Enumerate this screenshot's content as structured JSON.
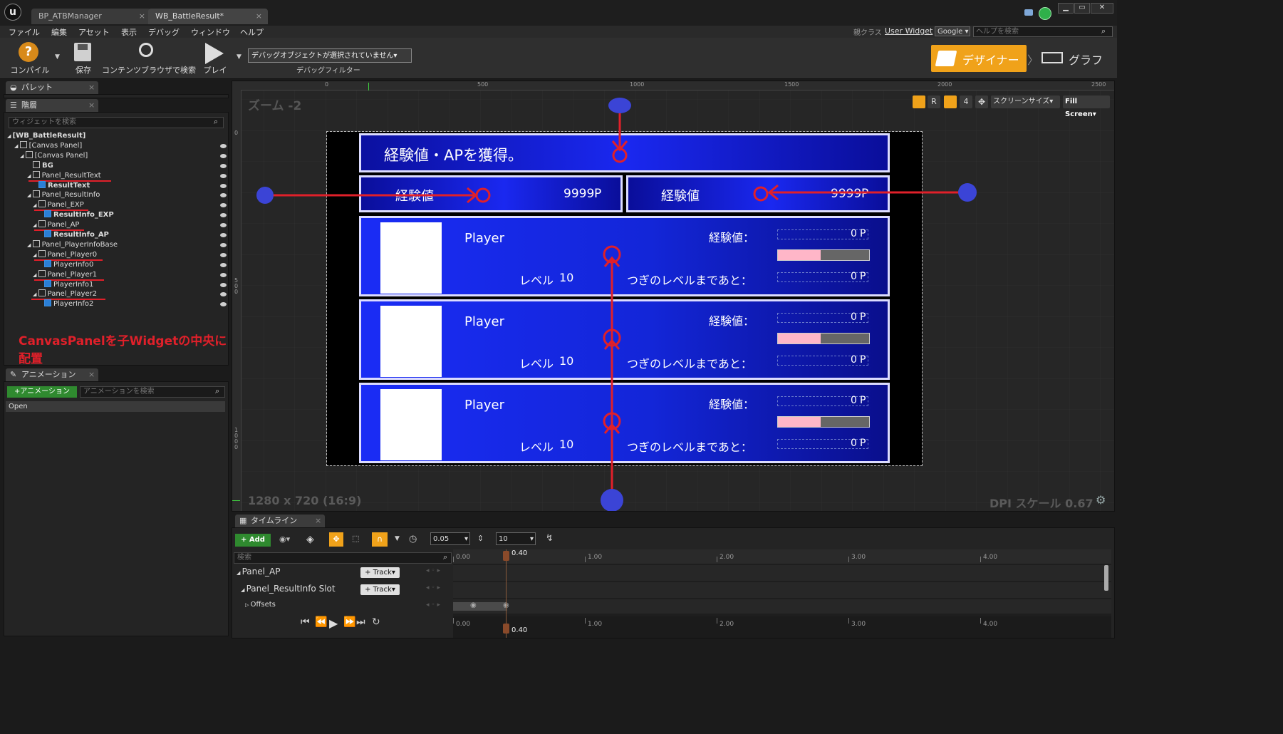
{
  "window": {
    "tabs": [
      {
        "label": "BP_ATBManager"
      },
      {
        "label": "WB_BattleResult*"
      }
    ],
    "controls": {
      "minimize": "▁",
      "maximize": "▭",
      "close": "✕"
    }
  },
  "menu": [
    "ファイル",
    "編集",
    "アセット",
    "表示",
    "デバッグ",
    "ウィンドウ",
    "ヘルプ"
  ],
  "parent_class": {
    "label": "親クラス",
    "value": "User Widget"
  },
  "search_engine": "Google",
  "help_search": {
    "placeholder": "ヘルプを検索"
  },
  "toolbar": {
    "compile": "コンパイル",
    "save": "保存",
    "browse": "コンテンツブラウザで検索",
    "play": "プレイ",
    "debug_object": "デバッグオブジェクトが選択されていません",
    "debug_filter": "デバッグフィルター"
  },
  "mode": {
    "designer": "デザイナー",
    "graph": "グラフ"
  },
  "palette": {
    "tab": "パレット"
  },
  "hierarchy": {
    "tab": "階層",
    "search_placeholder": "ウィジェットを検索",
    "items": [
      {
        "label": "[WB_BattleResult]",
        "bold": true
      },
      {
        "label": "[Canvas Panel]"
      },
      {
        "label": "[Canvas Panel]"
      },
      {
        "label": "BG",
        "bold": true
      },
      {
        "label": "Panel_ResultText"
      },
      {
        "label": "ResultText",
        "bold": true
      },
      {
        "label": "Panel_ResultInfo"
      },
      {
        "label": "Panel_EXP"
      },
      {
        "label": "ResultInfo_EXP",
        "bold": true
      },
      {
        "label": "Panel_AP"
      },
      {
        "label": "ResultInfo_AP",
        "bold": true
      },
      {
        "label": "Panel_PlayerInfoBase"
      },
      {
        "label": "Panel_Player0"
      },
      {
        "label": "PlayerInfo0"
      },
      {
        "label": "Panel_Player1"
      },
      {
        "label": "PlayerInfo1"
      },
      {
        "label": "Panel_Player2"
      },
      {
        "label": "PlayerInfo2"
      }
    ],
    "annotation": "CanvasPanelを子Widgetの中央に配置"
  },
  "animation": {
    "tab": "アニメーション",
    "add_button": "+アニメーション",
    "search_placeholder": "アニメーションを検索",
    "items": [
      "Open"
    ]
  },
  "viewport": {
    "zoom": "ズーム -2",
    "ruler_top": [
      "0",
      "500",
      "1000",
      "1500",
      "2000",
      "2500"
    ],
    "ruler_left": [
      "0",
      "5\n0\n0",
      "1\n0\n0\n0"
    ],
    "buttons": {
      "r": "R",
      "four": "4",
      "screen_size": "スクリーンサイズ",
      "fill": "Fill Screen"
    },
    "resolution": "1280 x 720 (16:9)",
    "dpi": "DPI スケール 0.67"
  },
  "game_ui": {
    "title": "経験値・APを獲得。",
    "exp_label": "経験値",
    "exp_value": "9999",
    "exp_unit": "P",
    "ap_label": "経験値",
    "ap_value": "9999",
    "ap_unit": "P",
    "players": [
      {
        "name": "Player",
        "level_label": "レベル",
        "level": "10",
        "exp_label": "経験値：",
        "exp_value": "0",
        "exp_unit": "P",
        "next_label": "つぎのレベルまであと：",
        "next_value": "0",
        "next_unit": "P",
        "progress": 0.47
      },
      {
        "name": "Player",
        "level_label": "レベル",
        "level": "10",
        "exp_label": "経験値：",
        "exp_value": "0",
        "exp_unit": "P",
        "next_label": "つぎのレベルまであと：",
        "next_value": "0",
        "next_unit": "P",
        "progress": 0.47
      },
      {
        "name": "Player",
        "level_label": "レベル",
        "level": "10",
        "exp_label": "経験値：",
        "exp_value": "0",
        "exp_unit": "P",
        "next_label": "つぎのレベルまであと：",
        "next_value": "0",
        "next_unit": "P",
        "progress": 0.47
      }
    ]
  },
  "timeline": {
    "tab": "タイムライン",
    "add": "+ Add",
    "step": "0.05",
    "frames": "10",
    "search_placeholder": "検索",
    "tracks": [
      {
        "label": "Panel_AP",
        "button": "+ Track"
      },
      {
        "label": "Panel_ResultInfo Slot",
        "button": "+ Track"
      },
      {
        "label": "Offsets"
      }
    ],
    "ticks": [
      "0.00",
      "1.00",
      "2.00",
      "3.00",
      "4.00"
    ],
    "current": "0.40"
  },
  "colors": {
    "accent_orange": "#f0a21a",
    "annotation_red": "#e0202a",
    "marker_blue": "#3b44d6",
    "panel_blue": "#1430e0"
  }
}
